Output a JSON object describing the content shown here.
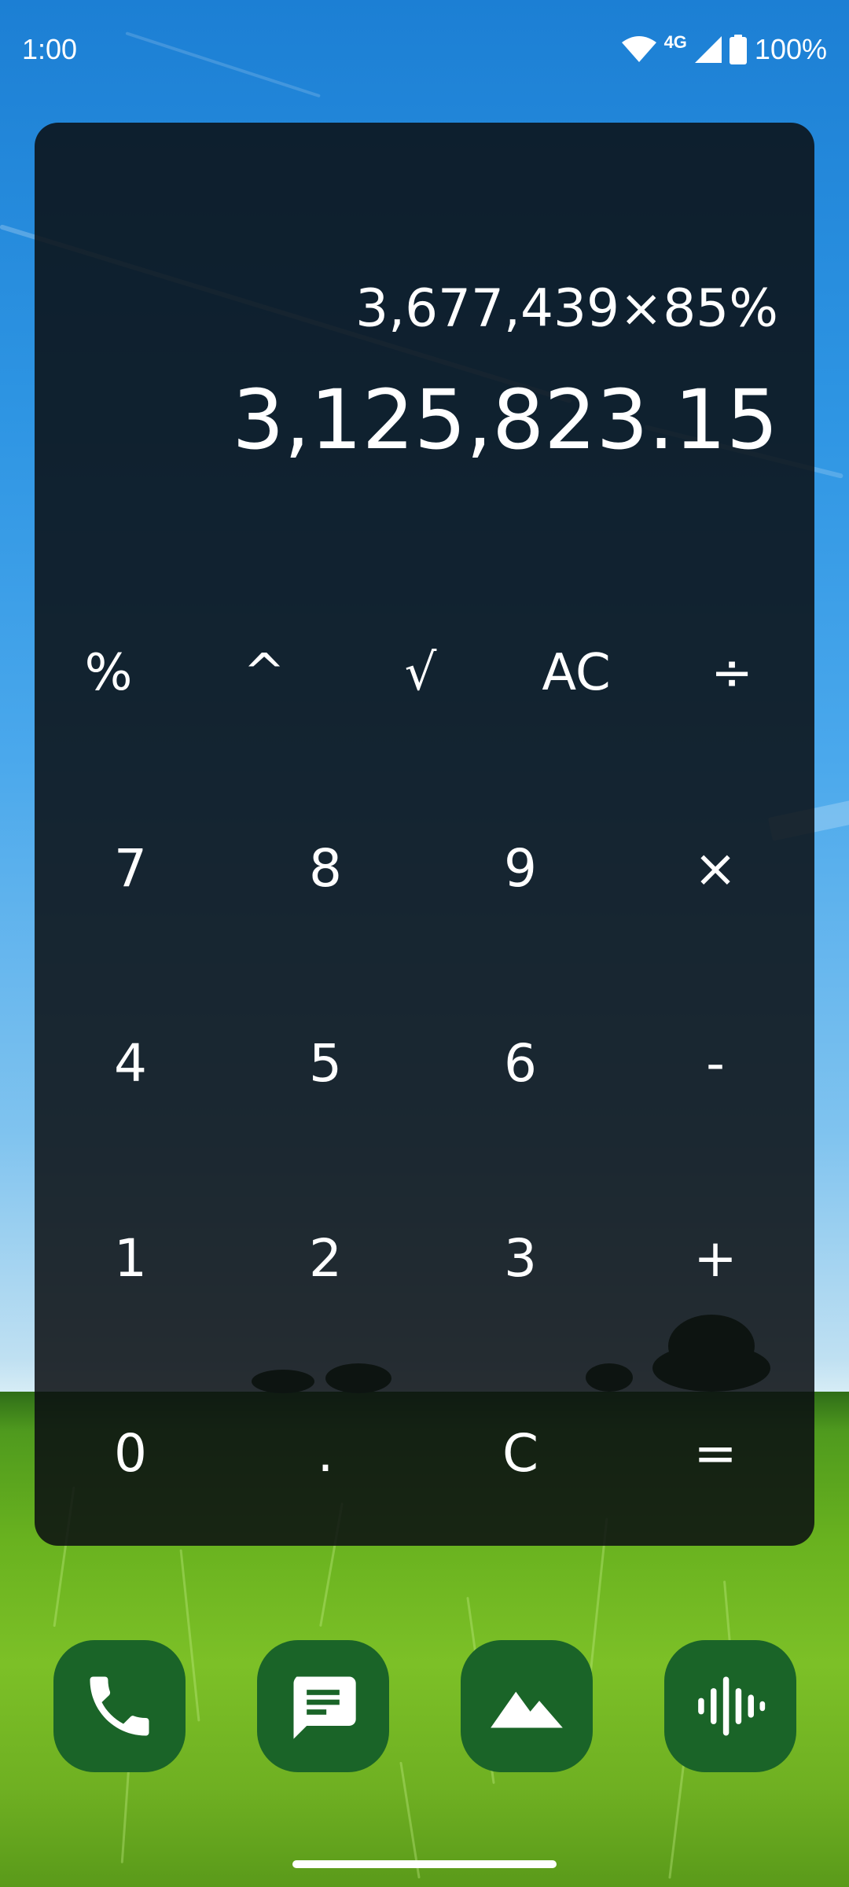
{
  "status_bar": {
    "time": "1:00",
    "network": "4G",
    "battery": "100%"
  },
  "calculator": {
    "expression": "3,677,439×85%",
    "result": "3,125,823.15",
    "function_keys": [
      "%",
      "^",
      "√",
      "AC",
      "÷"
    ],
    "number_rows": [
      [
        "7",
        "8",
        "9",
        "×"
      ],
      [
        "4",
        "5",
        "6",
        "-"
      ],
      [
        "1",
        "2",
        "3",
        "+"
      ],
      [
        "0",
        ".",
        "C",
        "="
      ]
    ]
  },
  "dock": {
    "apps": [
      "phone-icon",
      "messages-icon",
      "gallery-icon",
      "voice-recorder-icon"
    ],
    "accent_color": "#1a6428"
  }
}
